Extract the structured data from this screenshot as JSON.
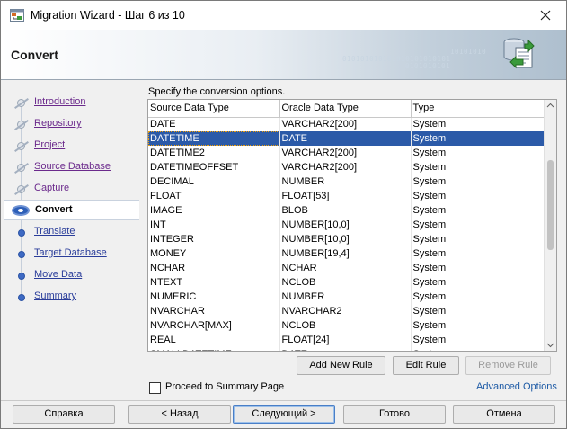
{
  "window": {
    "title": "Migration Wizard - Шаг 6 из 10",
    "icon": "migration-wizard-icon",
    "close_icon": "close-icon"
  },
  "banner": {
    "title": "Convert",
    "binary_lines": [
      "010101010101010101010101",
      "0101010101",
      "10101010"
    ],
    "icon": "database-convert-icon"
  },
  "nav": {
    "items": [
      {
        "label": "Introduction",
        "state": "done"
      },
      {
        "label": "Repository",
        "state": "done"
      },
      {
        "label": "Project",
        "state": "done"
      },
      {
        "label": "Source Database",
        "state": "done"
      },
      {
        "label": "Capture",
        "state": "done"
      },
      {
        "label": "Convert",
        "state": "current"
      },
      {
        "label": "Translate",
        "state": "future"
      },
      {
        "label": "Target Database",
        "state": "future"
      },
      {
        "label": "Move Data",
        "state": "future"
      },
      {
        "label": "Summary",
        "state": "future"
      }
    ]
  },
  "main": {
    "instruction": "Specify the conversion options.",
    "table": {
      "columns": [
        "Source Data Type",
        "Oracle Data Type",
        "Type"
      ],
      "selected_row": 1,
      "rows": [
        [
          "DATE",
          "VARCHAR2[200]",
          "System"
        ],
        [
          "DATETIME",
          "DATE",
          "System"
        ],
        [
          "DATETIME2",
          "VARCHAR2[200]",
          "System"
        ],
        [
          "DATETIMEOFFSET",
          "VARCHAR2[200]",
          "System"
        ],
        [
          "DECIMAL",
          "NUMBER",
          "System"
        ],
        [
          "FLOAT",
          "FLOAT[53]",
          "System"
        ],
        [
          "IMAGE",
          "BLOB",
          "System"
        ],
        [
          "INT",
          "NUMBER[10,0]",
          "System"
        ],
        [
          "INTEGER",
          "NUMBER[10,0]",
          "System"
        ],
        [
          "MONEY",
          "NUMBER[19,4]",
          "System"
        ],
        [
          "NCHAR",
          "NCHAR",
          "System"
        ],
        [
          "NTEXT",
          "NCLOB",
          "System"
        ],
        [
          "NUMERIC",
          "NUMBER",
          "System"
        ],
        [
          "NVARCHAR",
          "NVARCHAR2",
          "System"
        ],
        [
          "NVARCHAR[MAX]",
          "NCLOB",
          "System"
        ],
        [
          "REAL",
          "FLOAT[24]",
          "System"
        ],
        [
          "SMALLDATETIME",
          "DATE",
          "System"
        ]
      ]
    },
    "buttons": {
      "add_new_rule": "Add New Rule",
      "edit_rule": "Edit Rule",
      "remove_rule": "Remove Rule"
    },
    "proceed_checkbox": {
      "label": "Proceed to Summary Page",
      "checked": false
    },
    "advanced_options": "Advanced Options"
  },
  "footer": {
    "help": "Справка",
    "back": "< Назад",
    "next": "Следующий >",
    "finish": "Готово",
    "cancel": "Отмена"
  },
  "colors": {
    "selection": "#2b5aa8",
    "link": "#1d5aa5",
    "visited_link": "#6b2a8c"
  }
}
